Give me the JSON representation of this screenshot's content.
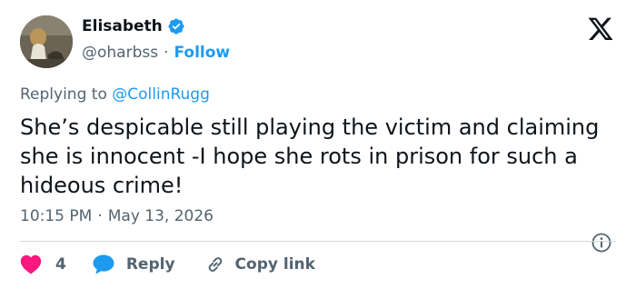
{
  "author": {
    "display_name": "Elisabeth",
    "handle": "@oharbss",
    "separator": "·",
    "follow_label": "Follow"
  },
  "tweet": {
    "reply_prefix": "Replying to",
    "reply_to": "@CollinRugg",
    "text": "She’s despicable still playing the victim and claiming she is innocent -I hope she rots in prison for such a hideous crime!",
    "time": "10:15 PM",
    "date_separator": "·",
    "date": "May 13, 2026"
  },
  "actions": {
    "like_count": "4",
    "reply_label": "Reply",
    "copy_label": "Copy link"
  },
  "colors": {
    "accent": "#1d9bf0",
    "like": "#f91880",
    "muted": "#536471",
    "text": "#0f1419"
  },
  "icons": {
    "verified": "verified-badge-icon",
    "logo": "x-logo-icon",
    "info": "info-icon",
    "like": "heart-icon",
    "reply": "speech-bubble-icon",
    "copy": "link-icon"
  }
}
